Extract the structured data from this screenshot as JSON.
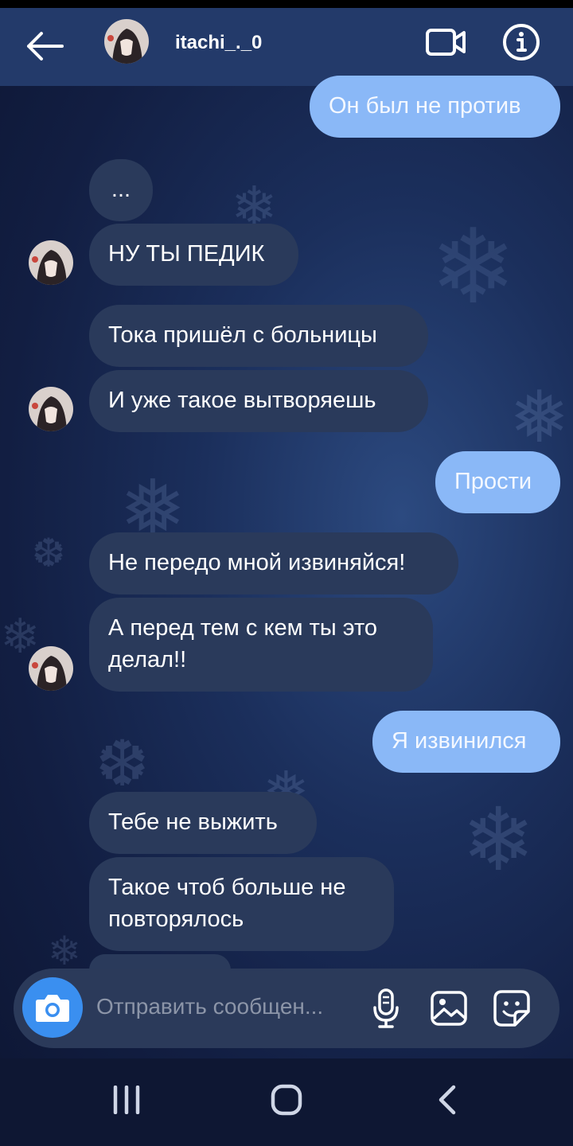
{
  "header": {
    "username": "itachi_._0"
  },
  "messages": [
    {
      "direction": "outgoing",
      "text": "Он был не против"
    },
    {
      "direction": "incoming",
      "text": "..."
    },
    {
      "direction": "incoming",
      "text": "НУ ТЫ ПЕДИК"
    },
    {
      "direction": "incoming",
      "text": "Тока пришёл с больницы"
    },
    {
      "direction": "incoming",
      "text": "И уже такое вытворяешь"
    },
    {
      "direction": "outgoing",
      "text": "Прости"
    },
    {
      "direction": "incoming",
      "text": "Не передо мной извиняйся!"
    },
    {
      "direction": "incoming",
      "text": "А перед тем с кем ты это делал!!"
    },
    {
      "direction": "outgoing",
      "text": "Я извинился"
    },
    {
      "direction": "incoming",
      "text": "Тебе не выжить"
    },
    {
      "direction": "incoming",
      "text": "Такое чтоб больше не повторялось"
    }
  ],
  "composer": {
    "placeholder": "Отправить сообщен..."
  },
  "icons": [
    "back-arrow-icon",
    "video-call-icon",
    "info-icon",
    "camera-icon",
    "microphone-icon",
    "gallery-icon",
    "sticker-icon",
    "recent-apps-icon",
    "home-icon",
    "nav-back-icon"
  ],
  "colors": {
    "header": "#233a6a",
    "incoming_bubble": "#2a3a5b",
    "outgoing_bubble": "#8ab8f7",
    "camera_button": "#3a8ff0"
  }
}
